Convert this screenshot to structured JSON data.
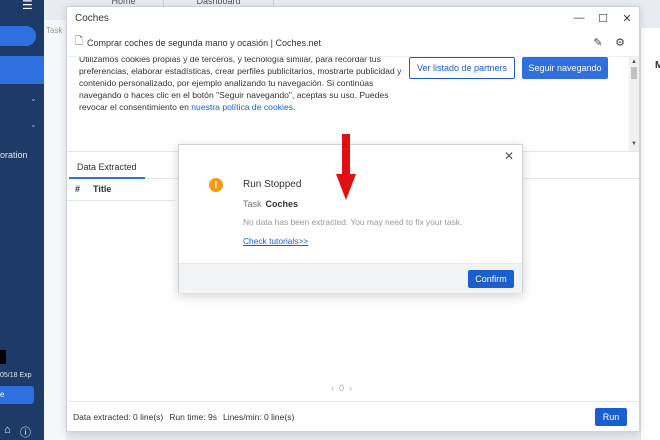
{
  "background_tabs": [
    {
      "label": "Home"
    },
    {
      "label": "Dashboard"
    }
  ],
  "sidebar": {
    "partial_text_left": "Task",
    "item_partial": "oration",
    "expiry_partial": "05/18 Exp"
  },
  "window": {
    "title": "Coches",
    "controls": {
      "minimize": "—",
      "maximize": "☐",
      "close": "✕"
    },
    "page_title": "Comprar coches de segunda mano y ocasión | Coches.net",
    "cookie_text": "Utilizamos cookies propias y de terceros, y tecnología similar, para recordar tus preferencias, elaborar estadísticas, crear perfiles publicitarios, mostrarte publicidad y contenido personalizado, por ejemplo analizando tu navegación. Si continúas navegando o haces clic en el botón \"Seguir navegando\", aceptas su uso. Puedes revocar el consentimiento en ",
    "cookie_link": "nuestra política de cookies",
    "cookie_end": ".",
    "btn_partners": "Ver listado de partners",
    "btn_seguir": "Seguir navegando",
    "right_edge_letter": "M"
  },
  "data_panel": {
    "tab": "Data Extracted",
    "columns": [
      "#",
      "Title"
    ],
    "pager": {
      "prev": "‹",
      "page": "0",
      "next": "›"
    }
  },
  "status": {
    "extracted": "Data extracted: 0 line(s)",
    "runtime": "Run time: 9s",
    "lines_per_min": "Lines/min: 0 line(s)",
    "run_button": "Run"
  },
  "dialog": {
    "title": "Run Stopped",
    "task_label": "Task",
    "task_name": "Coches",
    "message": "No data has been extracted. You may need to fix your task.",
    "link": "Check tutorials>>",
    "confirm": "Confirm"
  },
  "colors": {
    "sidebar": "#1e3a66",
    "accent": "#1a5fd0",
    "warning": "#f39a17",
    "annotation": "#e01010"
  }
}
